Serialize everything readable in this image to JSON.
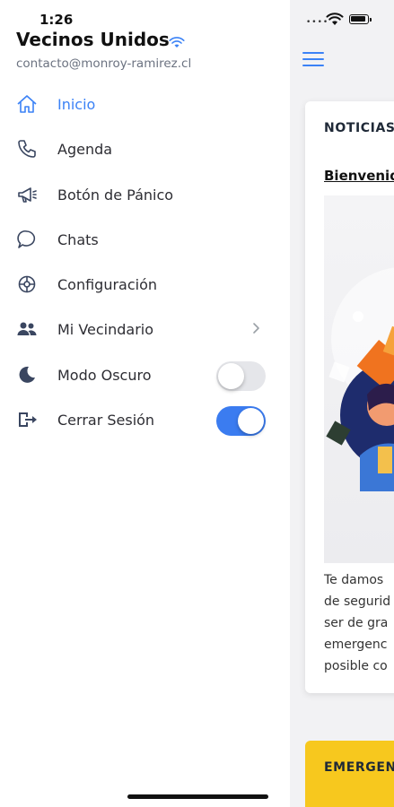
{
  "status_bar": {
    "time": "1:26"
  },
  "drawer": {
    "app_name": "Vecinos Unidos",
    "email": "contacto@monroy-ramirez.cl",
    "menu": [
      {
        "label": "Inicio",
        "icon": "home-icon",
        "active": true
      },
      {
        "label": "Agenda",
        "icon": "phone-icon"
      },
      {
        "label": "Botón de Pánico",
        "icon": "megaphone-icon"
      },
      {
        "label": "Chats",
        "icon": "chat-icon"
      },
      {
        "label": "Configuración",
        "icon": "settings-icon"
      },
      {
        "label": "Mi Vecindario",
        "icon": "people-icon",
        "has_chevron": true
      },
      {
        "label": "Modo Oscuro",
        "icon": "moon-icon",
        "toggle": false
      },
      {
        "label": "Cerrar Sesión",
        "icon": "logout-icon",
        "toggle": true
      }
    ]
  },
  "main": {
    "news_section_title": "NOTICIAS",
    "news_headline": "Bienvenido",
    "news_body": [
      "Te damos",
      "de segurid",
      "ser de gra",
      "emergenc",
      "posible co"
    ],
    "emergency_title": "EMERGENCIAS"
  },
  "colors": {
    "accent": "#3b82f6",
    "toggle_on": "#3b7cf0",
    "emergency": "#f7c81e"
  }
}
